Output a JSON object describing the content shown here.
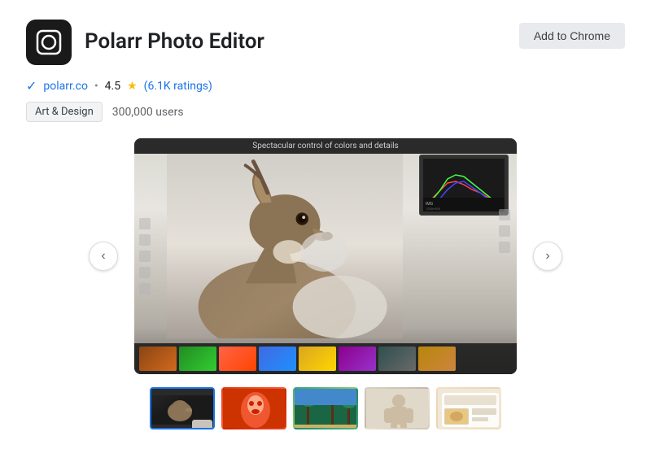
{
  "app": {
    "icon_alt": "Polarr Photo Editor app icon",
    "title": "Polarr Photo Editor",
    "website": "polarr.co",
    "rating": "4.5",
    "rating_symbol": "★",
    "ratings_count": "(6.1K ratings)",
    "category": "Art & Design",
    "users": "300,000 users",
    "add_button_label": "Add to Chrome"
  },
  "screenshot": {
    "title_bar_text": "Spectacular control of colors and details",
    "filmstrip_thumbs": 8
  },
  "thumbnails": [
    {
      "id": 1,
      "active": true,
      "label": "Screenshot 1"
    },
    {
      "id": 2,
      "active": false,
      "label": "Screenshot 2"
    },
    {
      "id": 3,
      "active": false,
      "label": "Screenshot 3"
    },
    {
      "id": 4,
      "active": false,
      "label": "Screenshot 4"
    },
    {
      "id": 5,
      "active": false,
      "label": "Screenshot 5"
    }
  ],
  "carousel": {
    "prev_label": "‹",
    "next_label": "›"
  },
  "colors": {
    "accent": "#1a73e8",
    "star": "#fbbc04",
    "bg": "#ffffff",
    "button_bg": "#e8eaed",
    "active_thumb_border": "#1a73e8"
  }
}
